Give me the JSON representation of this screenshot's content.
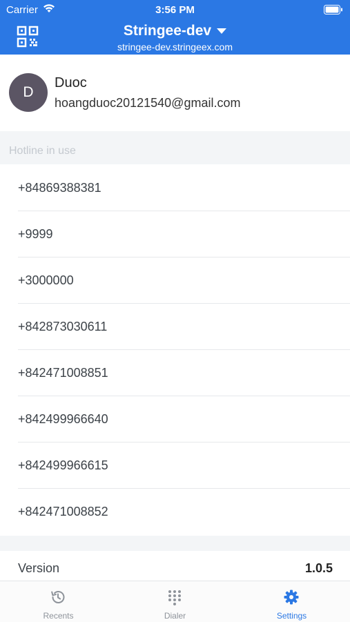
{
  "status_bar": {
    "carrier": "Carrier",
    "time": "3:56 PM"
  },
  "header": {
    "title": "Stringee-dev",
    "subtitle": "stringee-dev.stringeex.com",
    "accent_color": "#2b78e4",
    "left_icon": "qr-code-icon",
    "title_icon": "caret-down-icon"
  },
  "profile": {
    "avatar_letter": "D",
    "name": "Duoc",
    "email": "hoangduoc20121540@gmail.com"
  },
  "hotline_section": {
    "header": "Hotline in use",
    "items": [
      "+84869388381",
      "+9999",
      "+3000000",
      "+842873030611",
      "+842471008851",
      "+842499966640",
      "+842499966615",
      "+842471008852"
    ]
  },
  "version": {
    "label": "Version",
    "value": "1.0.5"
  },
  "tabs": [
    {
      "label": "Recents",
      "icon": "history-icon",
      "active": false
    },
    {
      "label": "Dialer",
      "icon": "dialpad-icon",
      "active": false
    },
    {
      "label": "Settings",
      "icon": "gear-icon",
      "active": true
    }
  ]
}
